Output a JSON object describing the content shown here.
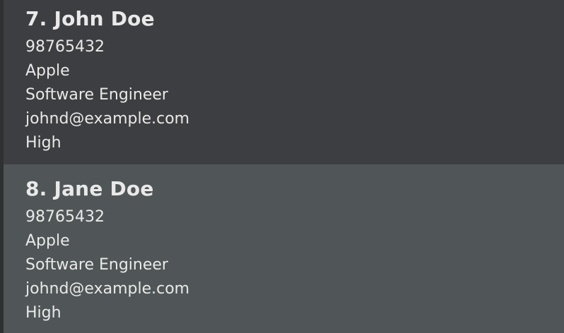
{
  "contacts": [
    {
      "title": "7. John Doe",
      "phone": "98765432",
      "company": "Apple",
      "role": "Software Engineer",
      "email": "johnd@example.com",
      "priority": "High"
    },
    {
      "title": "8. Jane Doe",
      "phone": "98765432",
      "company": "Apple",
      "role": "Software Engineer",
      "email": "johnd@example.com",
      "priority": "High"
    }
  ],
  "colors": {
    "card_default_bg": "#3d3e41",
    "card_selected_bg": "#505658",
    "text": "#e9e9e9"
  }
}
